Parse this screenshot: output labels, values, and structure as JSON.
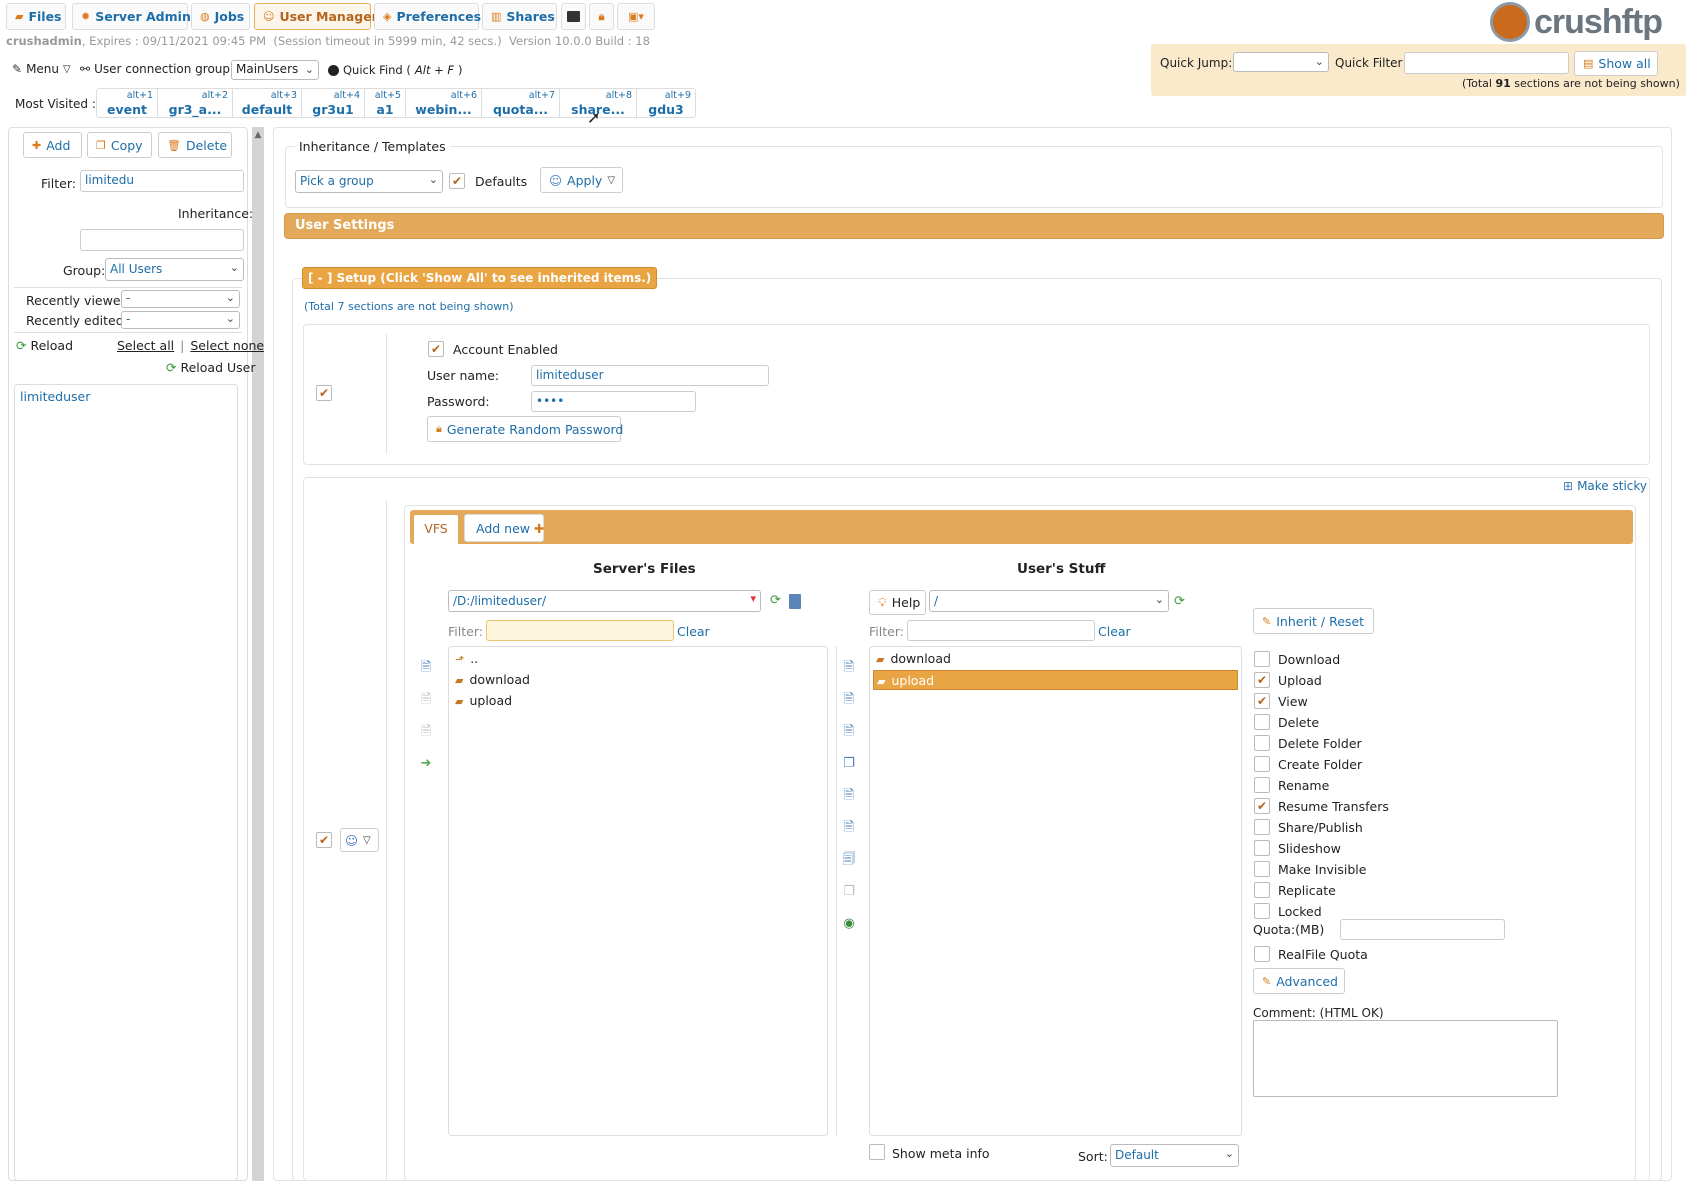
{
  "top_tabs": [
    {
      "label": "Files",
      "icon": "folder-icon"
    },
    {
      "label": "Server Admin",
      "icon": "gear-icon"
    },
    {
      "label": "Jobs",
      "icon": "jobs-icon"
    },
    {
      "label": "User Manager",
      "icon": "user-icon",
      "active": true
    },
    {
      "label": "Preferences",
      "icon": "preferences-icon"
    },
    {
      "label": "Shares",
      "icon": "shares-icon"
    }
  ],
  "session": {
    "user": "crushadmin",
    "expires": ", Expires : 09/11/2021 09:45 PM",
    "timeout": "(Session timeout in 5999 min, 42 secs.)",
    "version": "Version 10.0.0 Build : 18"
  },
  "menu_label": "Menu",
  "connection_group": {
    "label": "User connection group:",
    "value": "MainUsers"
  },
  "quick_find": {
    "label": "Quick Find (",
    "shortcut": "Alt + F",
    ")": ")"
  },
  "most_visited": {
    "label": "Most Visited :",
    "items": [
      {
        "key": "alt+1",
        "name": "event"
      },
      {
        "key": "alt+2",
        "name": "gr3_a..."
      },
      {
        "key": "alt+3",
        "name": "default"
      },
      {
        "key": "alt+4",
        "name": "gr3u1"
      },
      {
        "key": "alt+5",
        "name": "a1"
      },
      {
        "key": "alt+6",
        "name": "webin..."
      },
      {
        "key": "alt+7",
        "name": "quota..."
      },
      {
        "key": "alt+8",
        "name": "share..."
      },
      {
        "key": "alt+9",
        "name": "gdu3"
      }
    ]
  },
  "logo_text": "crushftp",
  "quick_panel": {
    "jump_label": "Quick Jump:",
    "filter_label": "Quick Filter",
    "show_all": "Show all",
    "note_pre": "(Total ",
    "note_count": "91",
    "note_post": " sections are not being shown)"
  },
  "left": {
    "add": "Add",
    "copy": "Copy",
    "delete": "Delete",
    "filter_label": "Filter:",
    "filter_value": "limitedu",
    "inheritance_label": "Inheritance:",
    "group_label": "Group:",
    "group_value": "All Users",
    "recently_viewed_label": "Recently viewed:",
    "recently_viewed_value": "-",
    "recently_edited_label": "Recently edited:",
    "recently_edited_value": "-",
    "reload": "Reload",
    "select_all": "Select all",
    "sep": "|",
    "select_none": "Select none",
    "reload_user": "Reload User",
    "users": [
      "limiteduser"
    ]
  },
  "inherit": {
    "title": "Inheritance / Templates",
    "pick_group": "Pick a group",
    "defaults": "Defaults",
    "apply": "Apply"
  },
  "user_settings": "User Settings",
  "setup": {
    "header": "[ - ] Setup (Click 'Show All' to see inherited items.)",
    "note": "(Total 7 sections are not being shown)",
    "account_enabled": "Account Enabled",
    "username_label": "User name:",
    "username_value": "limiteduser",
    "password_label": "Password:",
    "password_value": "••••",
    "generate": "Generate Random Password"
  },
  "make_sticky": "Make sticky",
  "vfs": {
    "tab_vfs": "VFS",
    "tab_add": "Add new",
    "server_title": "Server's Files",
    "server_path": "/D:/limiteduser/",
    "filter_label": "Filter:",
    "clear": "Clear",
    "server_items": [
      "..",
      "download",
      "upload"
    ],
    "user_title": "User's Stuff",
    "help": "Help",
    "user_path": "/",
    "user_items": [
      "download",
      "upload"
    ],
    "selected_item": "upload",
    "show_meta": "Show meta info",
    "sort_label": "Sort:",
    "sort_value": "Default"
  },
  "perms": {
    "inherit_reset": "Inherit / Reset",
    "items": [
      {
        "label": "Download",
        "checked": false
      },
      {
        "label": "Upload",
        "checked": true
      },
      {
        "label": "View",
        "checked": true
      },
      {
        "label": "Delete",
        "checked": false
      },
      {
        "label": "Delete Folder",
        "checked": false
      },
      {
        "label": "Create Folder",
        "checked": false
      },
      {
        "label": "Rename",
        "checked": false
      },
      {
        "label": "Resume Transfers",
        "checked": true
      },
      {
        "label": "Share/Publish",
        "checked": false
      },
      {
        "label": "Slideshow",
        "checked": false
      },
      {
        "label": "Make Invisible",
        "checked": false
      },
      {
        "label": "Replicate",
        "checked": false
      },
      {
        "label": "Locked",
        "checked": false
      }
    ],
    "quota_label": "Quota:(MB)",
    "realfile": "RealFile Quota",
    "advanced": "Advanced",
    "comment_label": "Comment: (HTML OK)"
  },
  "colors": {
    "accent": "#e2a95a",
    "link": "#1d6ea8",
    "highlight": "#e9a543"
  }
}
